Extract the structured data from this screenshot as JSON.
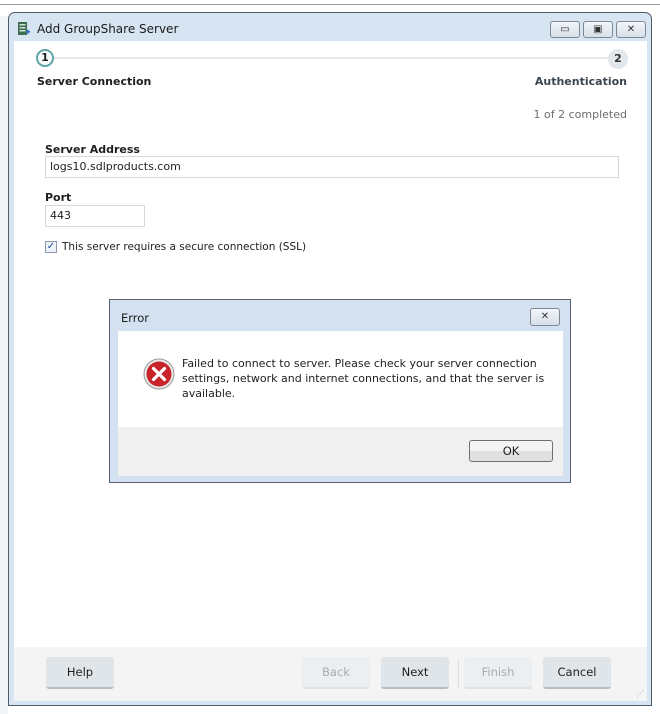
{
  "window": {
    "title": "Add GroupShare Server",
    "minimize_glyph": "▭",
    "maximize_glyph": "▣",
    "close_glyph": "✕"
  },
  "wizard": {
    "steps": [
      {
        "number": "1",
        "label": "Server Connection",
        "state": "current"
      },
      {
        "number": "2",
        "label": "Authentication",
        "state": "pending"
      }
    ],
    "progress_text": "1 of 2 completed"
  },
  "form": {
    "server_address_label": "Server Address",
    "server_address_value": "logs10.sdlproducts.com",
    "port_label": "Port",
    "port_value": "443",
    "ssl_label": "This server requires a secure connection (SSL)",
    "ssl_checked": true,
    "check_glyph": "✓"
  },
  "footer": {
    "help": "Help",
    "back": "Back",
    "next": "Next",
    "finish": "Finish",
    "cancel": "Cancel",
    "grip_glyph": "⋰"
  },
  "error_dialog": {
    "title": "Error",
    "close_glyph": "✕",
    "message": "Failed to connect to server. Please check your server connection settings, network and internet connections, and that the server is available.",
    "ok": "OK",
    "icon": "error-x-icon"
  },
  "colors": {
    "step_ring": "#5fa6a6",
    "error_red": "#c8242a",
    "titlebar": "#d7e4f2"
  }
}
